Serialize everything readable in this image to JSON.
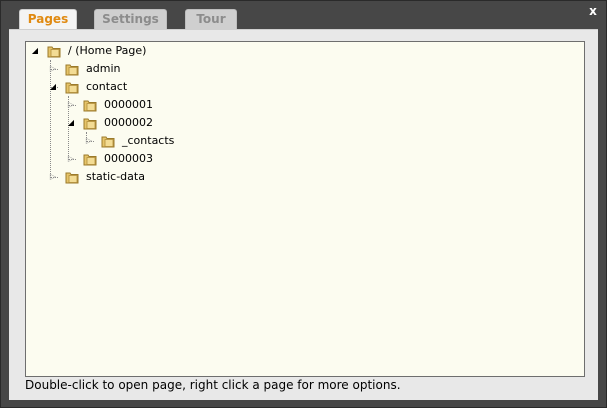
{
  "window": {
    "close_label": "x"
  },
  "tabs": [
    {
      "label": "Pages",
      "active": true
    },
    {
      "label": "Settings",
      "active": false
    },
    {
      "label": "Tour",
      "active": false
    }
  ],
  "tree": [
    {
      "label": "/ (Home Page)",
      "expanded": true
    },
    {
      "label": "admin",
      "expanded": false
    },
    {
      "label": "contact",
      "expanded": true
    },
    {
      "label": "0000001",
      "expanded": false
    },
    {
      "label": "0000002",
      "expanded": true
    },
    {
      "label": "_contacts",
      "expanded": false
    },
    {
      "label": "0000003",
      "expanded": false
    },
    {
      "label": "static-data",
      "expanded": false
    }
  ],
  "footer": {
    "hint": "Double-click to open page, right click a page for more options."
  },
  "colors": {
    "window_bg": "#474747",
    "panel_bg": "#e8e8e8",
    "tree_bg": "#fcfcf0",
    "active_tab_text": "#e08a12",
    "inactive_tab_text": "#8c8c8c",
    "folder_fill": "#e6c46a"
  }
}
